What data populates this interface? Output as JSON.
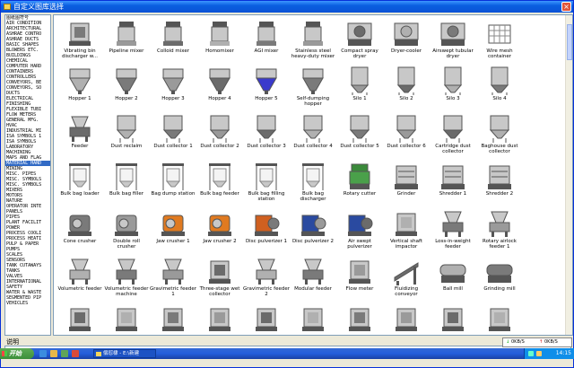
{
  "window": {
    "title": "自定义图库选择",
    "close_label": "×"
  },
  "sidebar": {
    "items": [
      "图纸图符号",
      "AIR CONDITION",
      "ARCHITECTURAL",
      "ASHRAE CONTRO",
      "ASHRAE DUCTS",
      "BASIC SHAPES",
      "BLOWERS ETC.",
      "BUILDINGS",
      "CHEMICAL",
      "COMPUTER HARD",
      "CONTAINERS",
      "CONTROLLERS",
      "CONVEYORS, BE",
      "CONVEYORS, SO",
      "DUCTS",
      "ELECTRICAL",
      "FINISHING",
      "FLEXIBLE TUBI",
      "FLOW METERS",
      "GENERAL MFG.",
      "HVAC",
      "INDUSTRIAL MI",
      "ISA SYMBOLS 1",
      "ISA SYMBOLS",
      "LABORATORY",
      "MACHINING",
      "MAPS AND FLAG",
      "MATERIAL HAND",
      "MINING",
      "MISC. PIPES",
      "MISC. SYMBOLS",
      "MISC. SYMBOLS",
      "MIXERS",
      "MOTORS",
      "NATURE",
      "OPERATOR INTE",
      "PANELS",
      "PIPES",
      "PLANT FACILIT",
      "POWER",
      "PROCESS COOLI",
      "PROCESS HEATI",
      "PULP & PAPER",
      "PUMPS",
      "SCALES",
      "SENSORS",
      "TANK CUTAWAYS",
      "TANKS",
      "VALVES",
      "INTERNATIONAL",
      "SAFETY",
      "WATER & WASTE",
      "SEGMENTED PIP",
      "VEHICLES"
    ],
    "selected_index": 27
  },
  "gallery": {
    "tiles": [
      {
        "label": "Vibrating bin discharger w...",
        "icon": "vibrating-bin-icon"
      },
      {
        "label": "Pipeline mixer",
        "icon": "mixer-icon"
      },
      {
        "label": "Colloid mixer",
        "icon": "mixer-icon"
      },
      {
        "label": "Homomixer",
        "icon": "mixer-icon"
      },
      {
        "label": "AGI mixer",
        "icon": "mixer-icon"
      },
      {
        "label": "Stainless steel heavy-duty mixer",
        "icon": "mixer-icon"
      },
      {
        "label": "Compact spray dryer",
        "icon": "dryer-icon"
      },
      {
        "label": "Dryer-cooler",
        "icon": "dryer-icon"
      },
      {
        "label": "Airswept tubular dryer",
        "icon": "dryer-icon"
      },
      {
        "label": "Wire mesh container",
        "icon": "container-icon"
      },
      {
        "label": "",
        "icon": ""
      },
      {
        "label": "Hopper 1",
        "icon": "hopper-icon"
      },
      {
        "label": "Hopper 2",
        "icon": "hopper-icon"
      },
      {
        "label": "Hopper 3",
        "icon": "hopper-icon"
      },
      {
        "label": "Hopper 4",
        "icon": "hopper-icon"
      },
      {
        "label": "Hopper 5",
        "icon": "hopper-icon"
      },
      {
        "label": "Self-dumping hopper",
        "icon": "hopper-icon"
      },
      {
        "label": "Silo 1",
        "icon": "silo-icon"
      },
      {
        "label": "Silo 2",
        "icon": "silo-icon"
      },
      {
        "label": "Silo 3",
        "icon": "silo-icon"
      },
      {
        "label": "Silo 4",
        "icon": "silo-icon"
      },
      {
        "label": "",
        "icon": ""
      },
      {
        "label": "Feeder",
        "icon": "feeder-icon"
      },
      {
        "label": "Dust reclaim",
        "icon": "dust-collector-icon"
      },
      {
        "label": "Dust collector 1",
        "icon": "dust-collector-icon"
      },
      {
        "label": "Dust collector 2",
        "icon": "dust-collector-icon"
      },
      {
        "label": "Dust collector 3",
        "icon": "dust-collector-icon"
      },
      {
        "label": "Dust collector 4",
        "icon": "dust-collector-icon"
      },
      {
        "label": "Dust collector 5",
        "icon": "dust-collector-icon"
      },
      {
        "label": "Dust collector 6",
        "icon": "dust-collector-icon"
      },
      {
        "label": "Cartridge dust collector",
        "icon": "dust-collector-icon"
      },
      {
        "label": "Baghouse dust collector",
        "icon": "dust-collector-icon"
      },
      {
        "label": "",
        "icon": ""
      },
      {
        "label": "Bulk bag loader",
        "icon": "bulk-bag-icon"
      },
      {
        "label": "Bulk bag filler",
        "icon": "bulk-bag-icon"
      },
      {
        "label": "Bag dump station",
        "icon": "bulk-bag-icon"
      },
      {
        "label": "Bulk bag feeder",
        "icon": "bulk-bag-icon"
      },
      {
        "label": "Bulk bag filling station",
        "icon": "bulk-bag-icon"
      },
      {
        "label": "Bulk bag discharger",
        "icon": "bulk-bag-icon"
      },
      {
        "label": "Rotary cutter",
        "icon": "cutter-icon"
      },
      {
        "label": "Grinder",
        "icon": "grinder-icon"
      },
      {
        "label": "Shredder 1",
        "icon": "shredder-icon"
      },
      {
        "label": "Shredder 2",
        "icon": "shredder-icon"
      },
      {
        "label": "",
        "icon": ""
      },
      {
        "label": "Cone crusher",
        "icon": "crusher-icon"
      },
      {
        "label": "Double roll crusher",
        "icon": "crusher-icon"
      },
      {
        "label": "Jaw crusher 1",
        "icon": "crusher-icon"
      },
      {
        "label": "Jaw crusher 2",
        "icon": "crusher-icon"
      },
      {
        "label": "Disc pulverizer 1",
        "icon": "pulverizer-icon"
      },
      {
        "label": "Disc pulverizer 2",
        "icon": "pulverizer-icon"
      },
      {
        "label": "Air swept pulverizer",
        "icon": "pulverizer-icon"
      },
      {
        "label": "Vertical shaft impactor",
        "icon": "impactor-icon"
      },
      {
        "label": "Loss-in-weight feeder",
        "icon": "feeder-icon"
      },
      {
        "label": "Rotary airlock feeder 1",
        "icon": "feeder-icon"
      },
      {
        "label": "",
        "icon": ""
      },
      {
        "label": "Volumetric feeder",
        "icon": "feeder-icon"
      },
      {
        "label": "Volumetric feeder machine",
        "icon": "feeder-icon"
      },
      {
        "label": "Gravimetric feeder 1",
        "icon": "feeder-icon"
      },
      {
        "label": "Three-stage wet collector",
        "icon": "collector-icon"
      },
      {
        "label": "Gravimetric feeder 2",
        "icon": "feeder-icon"
      },
      {
        "label": "Modular feeder",
        "icon": "feeder-icon"
      },
      {
        "label": "Flow meter",
        "icon": "flow-meter-icon"
      },
      {
        "label": "Fluidizing conveyor",
        "icon": "conveyor-icon"
      },
      {
        "label": "Ball mill",
        "icon": "mill-icon"
      },
      {
        "label": "Grinding mill",
        "icon": "mill-icon"
      },
      {
        "label": "",
        "icon": ""
      },
      {
        "label": "",
        "icon": "row7-icon"
      },
      {
        "label": "",
        "icon": "row7-icon"
      },
      {
        "label": "",
        "icon": "row7-icon"
      },
      {
        "label": "",
        "icon": "row7-icon"
      },
      {
        "label": "",
        "icon": "row7-icon"
      },
      {
        "label": "",
        "icon": "row7-icon"
      },
      {
        "label": "",
        "icon": "row7-icon"
      },
      {
        "label": "",
        "icon": "row7-icon"
      },
      {
        "label": "",
        "icon": "row7-icon"
      },
      {
        "label": "",
        "icon": "row7-icon"
      }
    ]
  },
  "description": {
    "label": "说明"
  },
  "netspeed": {
    "down": "0KB/S",
    "up": "0KB/S"
  },
  "taskbar": {
    "start_label": "开始",
    "task_label": "偿怼棣 - E:\\新建",
    "clock": "14:15"
  }
}
